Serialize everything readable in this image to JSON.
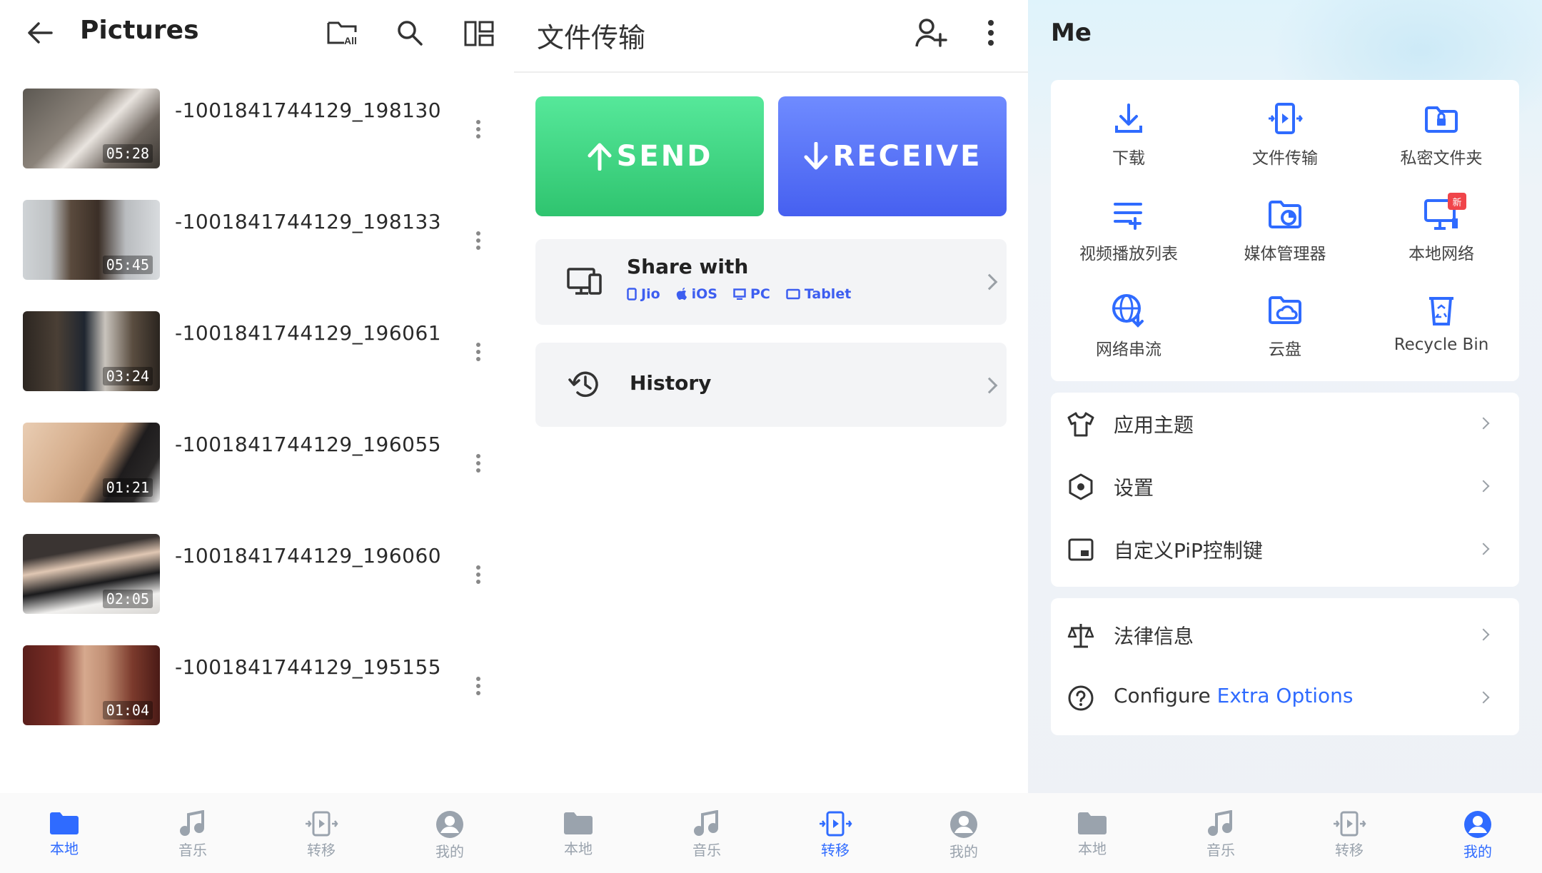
{
  "panel1": {
    "title": "Pictures",
    "videos": [
      {
        "name": "-1001841744129_198130",
        "duration": "05:28"
      },
      {
        "name": "-1001841744129_198133",
        "duration": "05:45"
      },
      {
        "name": "-1001841744129_196061",
        "duration": "03:24"
      },
      {
        "name": "-1001841744129_196055",
        "duration": "01:21"
      },
      {
        "name": "-1001841744129_196060",
        "duration": "02:05"
      },
      {
        "name": "-1001841744129_195155",
        "duration": "01:04"
      }
    ],
    "all_badge": "All"
  },
  "panel2": {
    "title": "文件传输",
    "send_label": "SEND",
    "receive_label": "RECEIVE",
    "share": {
      "title": "Share with",
      "tags": [
        "Jio",
        "iOS",
        "PC",
        "Tablet"
      ]
    },
    "history_label": "History"
  },
  "panel3": {
    "title": "Me",
    "grid": [
      {
        "label": "下载",
        "icon": "download-icon"
      },
      {
        "label": "文件传输",
        "icon": "file-transfer-icon"
      },
      {
        "label": "私密文件夹",
        "icon": "private-folder-icon"
      },
      {
        "label": "视频播放列表",
        "icon": "playlist-icon"
      },
      {
        "label": "媒体管理器",
        "icon": "media-manager-icon"
      },
      {
        "label": "本地网络",
        "icon": "local-network-icon",
        "badge": "新"
      },
      {
        "label": "网络串流",
        "icon": "network-stream-icon"
      },
      {
        "label": "云盘",
        "icon": "cloud-drive-icon"
      },
      {
        "label": "Recycle Bin",
        "icon": "recycle-bin-icon"
      }
    ],
    "settings": [
      {
        "label": "应用主题",
        "icon": "theme-icon"
      },
      {
        "label": "设置",
        "icon": "settings-icon"
      },
      {
        "label": "自定义PiP控制键",
        "icon": "pip-icon"
      }
    ],
    "legal_label": "法律信息",
    "configure_prefix": "Configure",
    "configure_highlight": "Extra Options"
  },
  "nav": {
    "items": [
      {
        "label": "本地",
        "icon": "folder-icon"
      },
      {
        "label": "音乐",
        "icon": "music-icon"
      },
      {
        "label": "转移",
        "icon": "transfer-icon"
      },
      {
        "label": "我的",
        "icon": "profile-icon"
      }
    ],
    "active": {
      "panel1": 0,
      "panel2": 2,
      "panel3": 3
    }
  },
  "colors": {
    "accent": "#2f6bff",
    "send_green": "#2fc46f",
    "receive_blue": "#4660f0",
    "badge_red": "#f0454a"
  }
}
